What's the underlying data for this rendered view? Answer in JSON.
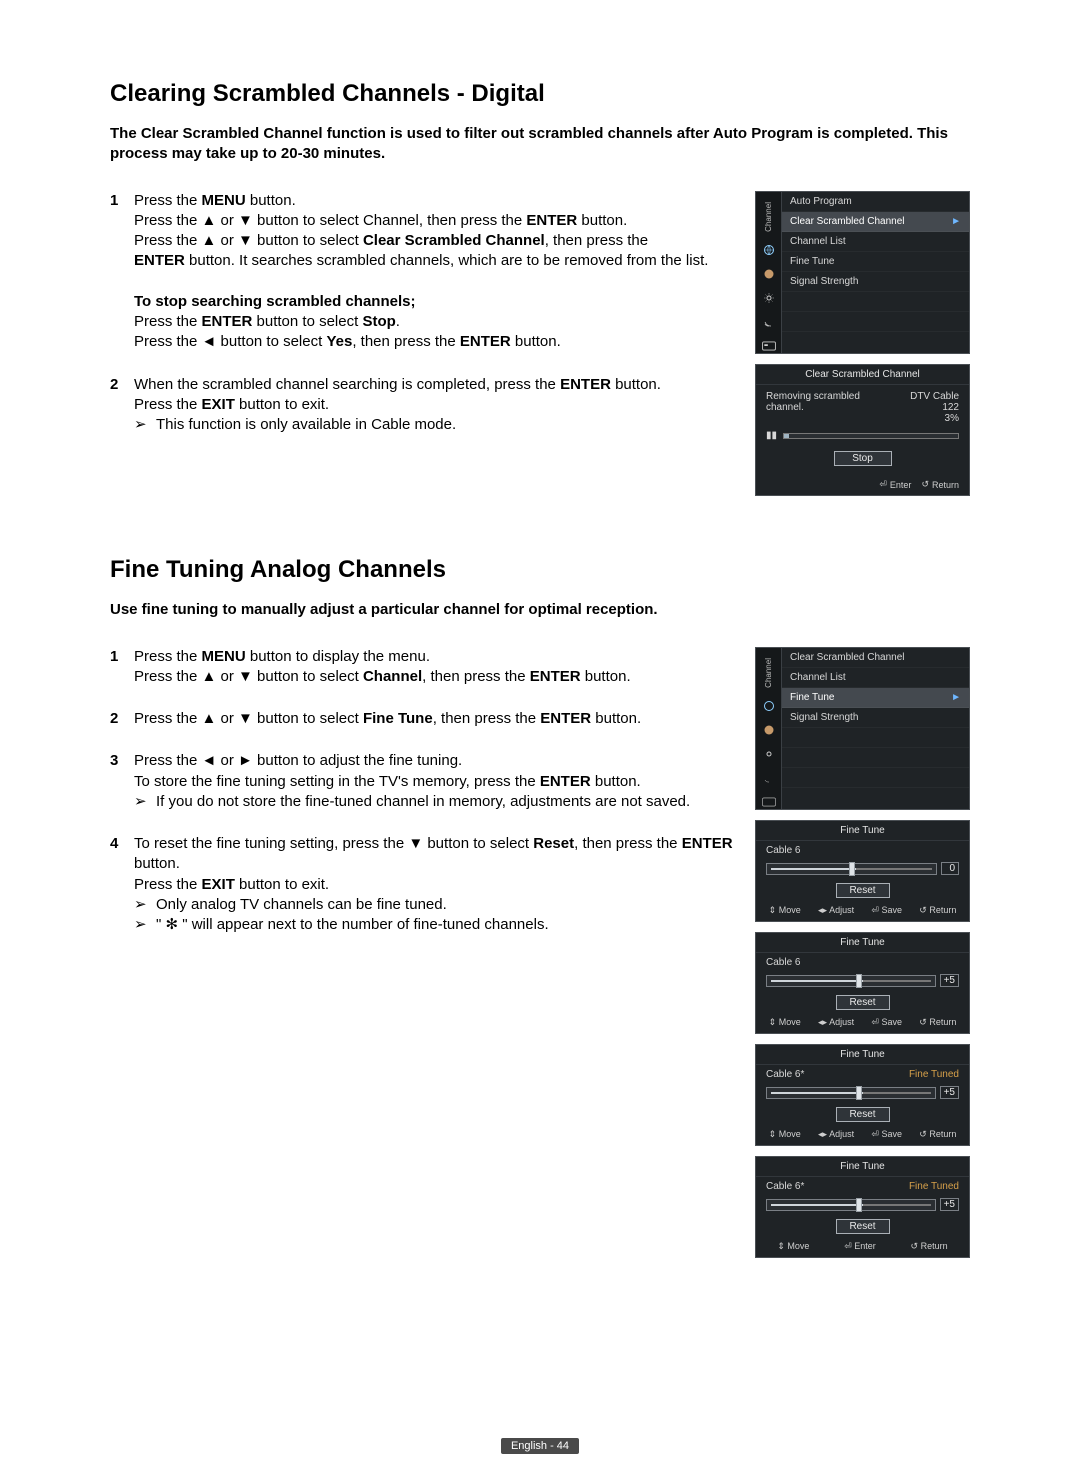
{
  "section1": {
    "title": "Clearing Scrambled Channels - Digital",
    "intro": "The Clear Scrambled Channel function is used to filter out scrambled channels after Auto Program is completed. This process may take up to 20-30 minutes.",
    "steps": [
      {
        "num": "1",
        "lines": [
          {
            "pre": "Press the ",
            "bold": "MENU",
            "post": " button."
          },
          {
            "pre": "Press the ▲ or ▼ button to select Channel, then press the ",
            "bold": "ENTER",
            "post": " button."
          },
          {
            "pre": "Press the ▲ or ▼ button to select ",
            "bold": "Clear Scrambled Channel",
            "post": ", then press the "
          },
          {
            "pre": "",
            "bold": "ENTER",
            "post": " button. It searches scrambled channels, which are to be removed from the list."
          }
        ],
        "sub_bold": "To stop searching scrambled channels;",
        "sub_lines": [
          {
            "pre": "Press the ",
            "bold": "ENTER",
            "post": " button to select ",
            "bold2": "Stop",
            "post2": "."
          },
          {
            "pre": "Press the ◄ button to select ",
            "bold": "Yes",
            "post": ", then press the ",
            "bold2": "ENTER",
            "post2": " button."
          }
        ]
      },
      {
        "num": "2",
        "lines": [
          {
            "pre": "When the scrambled channel searching is completed, press the ",
            "bold": "ENTER",
            "post": " button."
          },
          {
            "pre": "Press the ",
            "bold": "EXIT",
            "post": " button to exit."
          }
        ],
        "note": "This function is only available in Cable mode."
      }
    ]
  },
  "section2": {
    "title": "Fine Tuning Analog Channels",
    "intro": "Use fine tuning to manually adjust a particular channel for optimal reception.",
    "steps": [
      {
        "num": "1",
        "lines": [
          {
            "pre": "Press the ",
            "bold": "MENU",
            "post": " button to display the menu."
          },
          {
            "pre": "Press the ▲ or ▼ button to select ",
            "bold": "Channel",
            "post": ", then press the ",
            "bold2": "ENTER",
            "post2": " button."
          }
        ]
      },
      {
        "num": "2",
        "lines": [
          {
            "pre": "Press the ▲ or ▼ button to select ",
            "bold": "Fine Tune",
            "post": ", then press the ",
            "bold2": "ENTER",
            "post2": " button."
          }
        ]
      },
      {
        "num": "3",
        "lines": [
          {
            "pre": "Press the ◄ or ► button to adjust the fine tuning.",
            "bold": "",
            "post": ""
          },
          {
            "pre": "To store the fine tuning setting in the TV's memory, press the ",
            "bold": "ENTER",
            "post": " button."
          }
        ],
        "note": "If you do not store the fine-tuned channel in memory, adjustments are not saved."
      },
      {
        "num": "4",
        "lines": [
          {
            "pre": "To reset the fine tuning setting, press the ▼ button to select ",
            "bold": "Reset",
            "post": ", then press the ",
            "bold2": "ENTER",
            "post2": " button."
          },
          {
            "pre": "Press the ",
            "bold": "EXIT",
            "post": " button to exit."
          }
        ],
        "notes": [
          "Only analog TV channels can be fine tuned.",
          "\" ✻ \" will appear next to the number of fine-tuned channels."
        ]
      }
    ]
  },
  "osd1": {
    "tab": "Channel",
    "items": [
      "Auto Program",
      "Clear Scrambled Channel",
      "Channel List",
      "Fine Tune",
      "Signal Strength"
    ],
    "highlight_index": 1
  },
  "osd2": {
    "title": "Clear Scrambled Channel",
    "msg": "Removing scrambled channel.",
    "sub": "DTV Cable 122",
    "percent": "3%",
    "percent_num": 3,
    "stop": "Stop",
    "foot": {
      "enter": "Enter",
      "return": "Return"
    }
  },
  "osd3": {
    "tab": "Channel",
    "items": [
      "Clear Scrambled Channel",
      "Channel List",
      "Fine Tune",
      "Signal Strength"
    ],
    "highlight_index": 2
  },
  "finetune_common": {
    "title": "Fine Tune",
    "reset": "Reset",
    "foot": {
      "move": "Move",
      "adjust": "Adjust",
      "save": "Save",
      "enter": "Enter",
      "return": "Return"
    }
  },
  "ft_panels": [
    {
      "label": "Cable 6",
      "value": "0",
      "pos": 50,
      "tuned": false,
      "foot_save": true
    },
    {
      "label": "Cable 6",
      "value": "+5",
      "pos": 55,
      "tuned": false,
      "foot_save": true
    },
    {
      "label": "Cable 6*",
      "value": "+5",
      "pos": 55,
      "tuned": true,
      "tuned_label": "Fine Tuned",
      "foot_save": true
    },
    {
      "label": "Cable 6*",
      "value": "+5",
      "pos": 55,
      "tuned": true,
      "tuned_label": "Fine Tuned",
      "foot_save": false
    }
  ],
  "footer": "English - 44"
}
